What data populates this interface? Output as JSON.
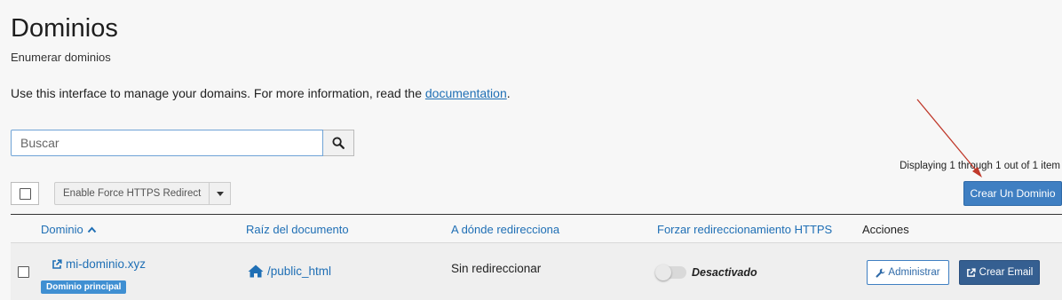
{
  "header": {
    "title": "Dominios",
    "subtitle": "Enumerar dominios"
  },
  "intro": {
    "text": "Use this interface to manage your domains. For more information, read the ",
    "link": "documentation",
    "suffix": "."
  },
  "search": {
    "placeholder": "Buscar",
    "value": ""
  },
  "pagination": {
    "info": "Displaying 1 through 1 out of 1 item"
  },
  "toolbar": {
    "force_https_label": "Enable Force HTTPS Redirect",
    "create_domain_label": "Crear Un Dominio"
  },
  "table": {
    "columns": [
      "Dominio",
      "Raíz del documento",
      "A dónde redirecciona",
      "Forzar redireccionamiento HTTPS",
      "Acciones"
    ],
    "rows": [
      {
        "domain": "mi-dominio.xyz",
        "badge": "Dominio principal",
        "docroot": "/public_html",
        "redirect": "Sin redireccionar",
        "https_status": "Desactivado",
        "actions": [
          "Administrar",
          "Crear Email"
        ]
      }
    ]
  },
  "colors": {
    "accent": "#3f7fc2",
    "link": "#1f6fb5",
    "annotation_arrow": "#c0392b"
  },
  "icons": [
    "search-icon",
    "sort-up-icon",
    "external-link-icon",
    "home-icon",
    "wrench-icon",
    "caret-down-icon"
  ]
}
